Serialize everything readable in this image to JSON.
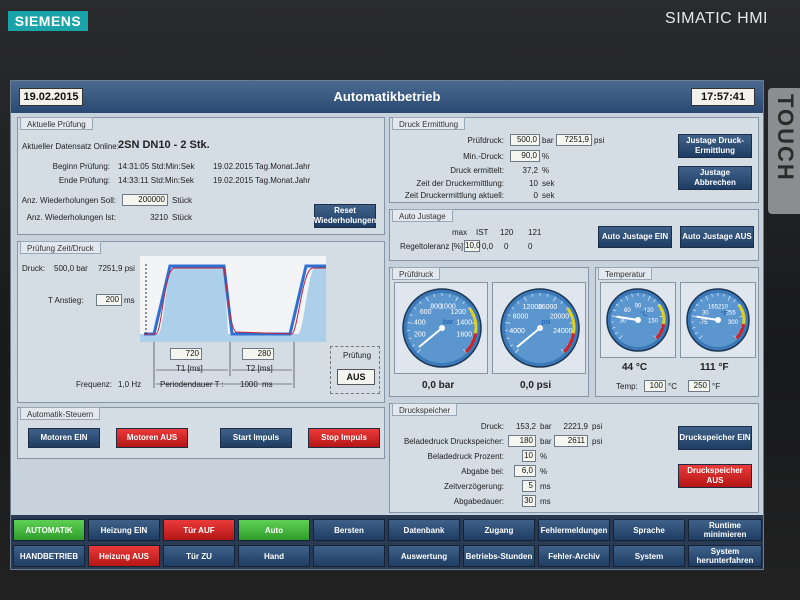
{
  "bezel": {
    "logo": "SIEMENS",
    "brand": "SIMATIC HMI",
    "touch": "TOUCH"
  },
  "header": {
    "date": "19.02.2015",
    "title": "Automatikbetrieb",
    "time": "17:57:41"
  },
  "aktuelle_pruefung": {
    "title": "Aktuelle Prüfung",
    "datensatz_label": "Aktueller Datensatz Online:",
    "datensatz_value": "2SN DN10 - 2 Stk.",
    "begin_label": "Beginn Prüfung:",
    "begin_time": "14:31:05 Std:Min:Sek",
    "begin_date": "19.02.2015 Tag.Monat.Jahr",
    "ende_label": "Ende Prüfung:",
    "ende_time": "14:33:11 Std:Min:Sek",
    "ende_date": "19.02.2015 Tag.Monat.Jahr",
    "soll_label": "Anz. Wiederholungen Soll:",
    "soll_value": "200000",
    "soll_unit": "Stück",
    "ist_label": "Anz. Wiederholungen Ist:",
    "ist_value": "3210",
    "ist_unit": "Stück",
    "reset_label": "Reset Wiederholungen"
  },
  "zeit_druck": {
    "title": "Prüfung Zeit/Druck",
    "druck_label": "Druck:",
    "druck_bar": "500,0 bar",
    "druck_psi": "7251,9 psi",
    "anstieg_label": "T Anstieg:",
    "anstieg_value": "200",
    "anstieg_unit": "ms",
    "t1_value": "720",
    "t1_label": "T1 [ms]",
    "t2_value": "280",
    "t2_label": "T2 [ms]",
    "frequenz_label": "Frequenz:",
    "frequenz_value": "1,0 Hz",
    "periode_label": "Periodendauer T :",
    "periode_value": "1000",
    "periode_unit": "ms",
    "pruefung_label": "Prüfung",
    "pruefung_status": "AUS"
  },
  "automatik_steuern": {
    "title": "Automatik-Steuern",
    "motoren_ein": "Motoren EIN",
    "motoren_aus": "Motoren AUS",
    "start_impuls": "Start Impuls",
    "stop_impuls": "Stop Impuls"
  },
  "druck_ermittlung": {
    "title": "Druck Ermittlung",
    "pruefdruck_label": "Prüfdruck:",
    "pruefdruck_value": "500,0",
    "pruefdruck_unit": "bar",
    "pruefdruck_psi": "7251,9",
    "psi_unit": "psi",
    "min_label": "Min.-Druck:",
    "min_value": "90,0",
    "min_unit": "%",
    "ermittelt_label": "Druck ermittelt:",
    "ermittelt_value": "37,2",
    "ermittelt_unit": "%",
    "zeit_label": "Zeit der Druckermittlung:",
    "zeit_value": "10",
    "zeit_unit": "sek",
    "zeit_akt_label": "Zeit Druckermittlung aktuell:",
    "zeit_akt_value": "0",
    "zeit_akt_unit": "sek",
    "justage_btn": "Justage Druck-Ermittlung",
    "abbrechen_btn": "Justage Abbrechen"
  },
  "auto_justage": {
    "title": "Auto Justage",
    "col_max": "max",
    "col_ist": "IST",
    "col_120": "120",
    "col_121": "121",
    "regel_label": "Regeltoleranz [%]",
    "regel_value": "10,0",
    "v1": "0,0",
    "v2": "0",
    "v3": "0",
    "ein_btn": "Auto Justage EIN",
    "aus_btn": "Auto Justage AUS"
  },
  "pruefdruck": {
    "title": "Prüfdruck",
    "bar_value": "0,0 bar",
    "psi_value": "0,0 psi",
    "bar_unit": "bar",
    "psi_unit": "psi",
    "bar_ticks": [
      "200",
      "400",
      "600",
      "800",
      "1000",
      "1200",
      "1400",
      "1600"
    ],
    "psi_ticks": [
      "4000",
      "8000",
      "12000",
      "16000",
      "20000",
      "24000"
    ]
  },
  "temperatur": {
    "title": "Temperatur",
    "c_value": "44 °C",
    "f_value": "111 °F",
    "c_unit": "°C",
    "f_unit": "°F",
    "c_ticks": [
      "30",
      "60",
      "90",
      "120",
      "150"
    ],
    "f_ticks": [
      "-75",
      "30",
      "165",
      "210",
      "255",
      "300"
    ],
    "temp_label": "Temp:",
    "temp_c": "100",
    "temp_c_unit": "°C",
    "temp_f": "250",
    "temp_f_unit": "°F"
  },
  "druckspeicher": {
    "title": "Druckspeicher",
    "druck_label": "Druck:",
    "druck_value": "153,2",
    "druck_unit": "bar",
    "druck_psi": "2221,9",
    "psi_unit": "psi",
    "belade_label": "Beladedruck Druckspeicher:",
    "belade_value": "180",
    "belade_unit": "bar",
    "belade_psi": "2611",
    "belade_prozent_label": "Beladedruck Prozent:",
    "belade_prozent_value": "10",
    "belade_prozent_unit": "%",
    "abgabe_label": "Abgabe bei:",
    "abgabe_value": "6,0",
    "abgabe_unit": "%",
    "zeitverz_label": "Zeitverzögerung:",
    "zeitverz_value": "5",
    "zeitverz_unit": "ms",
    "abgabedauer_label": "Abgabedauer:",
    "abgabedauer_value": "30",
    "abgabedauer_unit": "ms",
    "ein_btn": "Druckspeicher EIN",
    "aus_btn": "Druckspeicher AUS"
  },
  "nav": {
    "row1": [
      "AUTOMATIK",
      "Heizung EIN",
      "Tür AUF",
      "Auto",
      "Bersten",
      "Datenbank",
      "Zugang",
      "Fehlermeldungen",
      "Sprache",
      "Runtime minimieren"
    ],
    "row2": [
      "HANDBETRIEB",
      "Heizung AUS",
      "Tür ZU",
      "Hand",
      "",
      "Auswertung",
      "Betriebs-Stunden",
      "Fehler-Archiv",
      "System",
      "System herunterfahren"
    ]
  },
  "colors": {
    "accent": "#1f3d63",
    "red": "#d22a2a",
    "green": "#3fb437",
    "logo": "#1aa3a8"
  }
}
